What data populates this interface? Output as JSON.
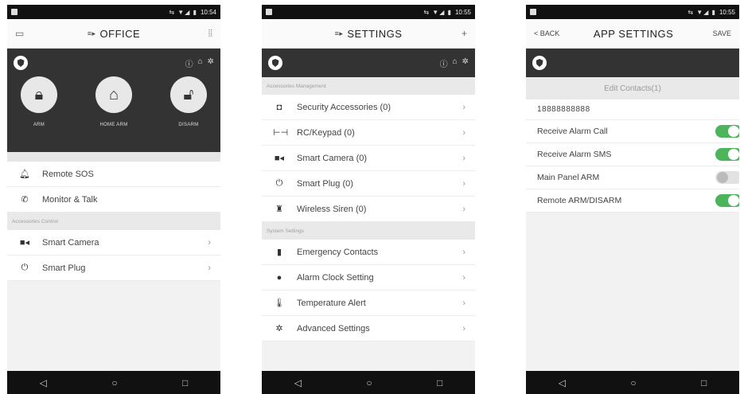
{
  "status": {
    "time1": "10:54",
    "time2": "10:55",
    "time3": "10:55"
  },
  "screen1": {
    "title": "OFFICE",
    "arm": [
      {
        "label": "ARM",
        "icon": "lock-icon"
      },
      {
        "label": "HOME ARM",
        "icon": "home-icon"
      },
      {
        "label": "DISARM",
        "icon": "unlock-icon"
      }
    ],
    "items": [
      {
        "label": "Remote SOS",
        "icon": "bell-icon"
      },
      {
        "label": "Monitor & Talk",
        "icon": "phone-icon"
      }
    ],
    "section": "Accessories Control",
    "section_items": [
      {
        "label": "Smart Camera",
        "icon": "camera-icon"
      },
      {
        "label": "Smart Plug",
        "icon": "power-icon"
      }
    ]
  },
  "screen2": {
    "title": "SETTINGS",
    "add": "+",
    "section1": "Accessories Management",
    "items1": [
      {
        "label": "Security Accessories (0)",
        "icon": "sensor-icon"
      },
      {
        "label": "RC/Keypad (0)",
        "icon": "remote-icon"
      },
      {
        "label": "Smart Camera (0)",
        "icon": "camera-icon"
      },
      {
        "label": "Smart Plug (0)",
        "icon": "power-icon"
      },
      {
        "label": "Wireless Siren (0)",
        "icon": "siren-icon"
      }
    ],
    "section2": "System Settings",
    "items2": [
      {
        "label": "Emergency Contacts",
        "icon": "contacts-icon"
      },
      {
        "label": "Alarm Clock Setting",
        "icon": "clock-icon"
      },
      {
        "label": "Temperature Alert",
        "icon": "thermometer-icon"
      },
      {
        "label": "Advanced Settings",
        "icon": "gear-icon"
      }
    ]
  },
  "screen3": {
    "back": "< BACK",
    "title": "APP SETTINGS",
    "save": "SAVE",
    "edit": "Edit Contacts(1)",
    "phone": "18888888888",
    "toggles": [
      {
        "label": "Receive Alarm Call",
        "on": true
      },
      {
        "label": "Receive Alarm SMS",
        "on": true
      },
      {
        "label": "Main Panel ARM",
        "on": false
      },
      {
        "label": "Remote ARM/DISARM",
        "on": true
      }
    ]
  },
  "nav": {
    "back": "◁",
    "home": "○",
    "recent": "□"
  }
}
